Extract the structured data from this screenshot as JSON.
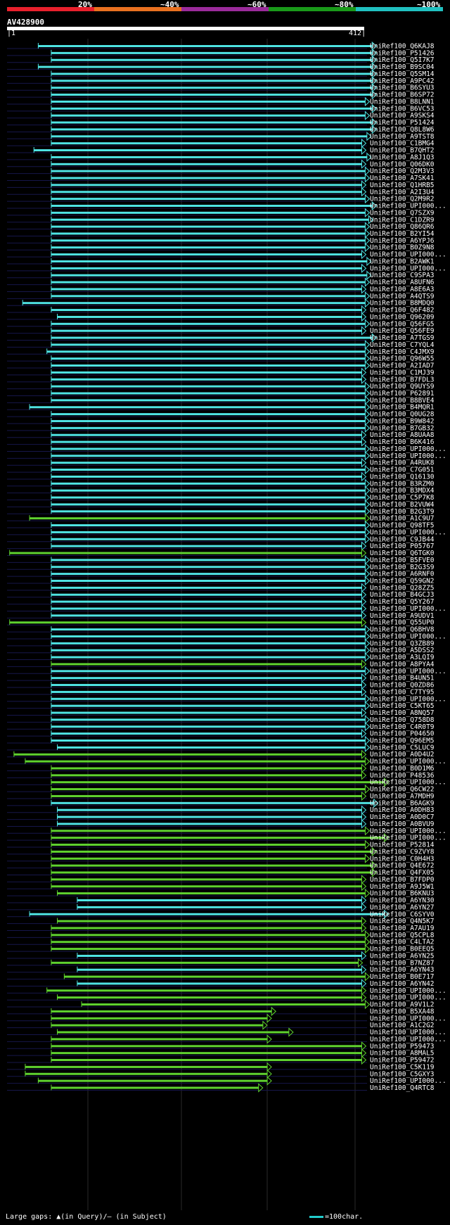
{
  "chart_data": {
    "type": "bar",
    "query": {
      "name": "AV428900",
      "start": 1,
      "end": 412
    },
    "identity_legend": [
      {
        "label": "20%",
        "color": "#e8202c"
      },
      {
        "label": "~40%",
        "color": "#e87020"
      },
      {
        "label": "~60%",
        "color": "#9b2b9b"
      },
      {
        "label": "~80%",
        "color": "#1a9a1a"
      },
      {
        "label": "~100%",
        "color": "#20c0c0"
      }
    ],
    "grid": true,
    "hits": [
      {
        "label": "UniRef100_Q6KAJ8",
        "start": 36,
        "end": 426,
        "color": "#4fe3e3"
      },
      {
        "label": "UniRef100_P51426",
        "start": 51,
        "end": 426,
        "color": "#4fe3e3"
      },
      {
        "label": "UniRef100_Q5I7K7",
        "start": 51,
        "end": 426,
        "color": "#4fe3e3"
      },
      {
        "label": "UniRef100_B9SC04",
        "start": 36,
        "end": 426,
        "color": "#4fe3e3"
      },
      {
        "label": "UniRef100_Q5SM14",
        "start": 51,
        "end": 426,
        "color": "#4fe3e3"
      },
      {
        "label": "UniRef100_A9PC42",
        "start": 51,
        "end": 426,
        "color": "#4fe3e3"
      },
      {
        "label": "UniRef100_B6SYU3",
        "start": 51,
        "end": 426,
        "color": "#4fe3e3"
      },
      {
        "label": "UniRef100_B6SP72",
        "start": 51,
        "end": 426,
        "color": "#4fe3e3"
      },
      {
        "label": "UniRef100_B8LNN1",
        "start": 51,
        "end": 418,
        "color": "#4fe3e3"
      },
      {
        "label": "UniRef100_B6VC53",
        "start": 51,
        "end": 426,
        "color": "#4fe3e3"
      },
      {
        "label": "UniRef100_A9SKS4",
        "start": 51,
        "end": 418,
        "color": "#4fe3e3"
      },
      {
        "label": "UniRef100_P51424",
        "start": 51,
        "end": 426,
        "color": "#4fe3e3"
      },
      {
        "label": "UniRef100_Q8L8W6",
        "start": 51,
        "end": 426,
        "color": "#4fe3e3"
      },
      {
        "label": "UniRef100_A9TST8",
        "start": 51,
        "end": 420,
        "color": "#4fe3e3"
      },
      {
        "label": "UniRef100_C1BMG4",
        "start": 51,
        "end": 414,
        "color": "#4fe3e3"
      },
      {
        "label": "UniRef100_B7QHT2",
        "start": 31,
        "end": 414,
        "color": "#4fe3e3"
      },
      {
        "label": "UniRef100_A8J1Q3",
        "start": 51,
        "end": 420,
        "color": "#4fe3e3"
      },
      {
        "label": "UniRef100_Q06DK0",
        "start": 51,
        "end": 414,
        "color": "#4fe3e3"
      },
      {
        "label": "UniRef100_Q2M3V3",
        "start": 51,
        "end": 418,
        "color": "#4fe3e3"
      },
      {
        "label": "UniRef100_A7SK41",
        "start": 51,
        "end": 418,
        "color": "#4fe3e3"
      },
      {
        "label": "UniRef100_Q1HRB5",
        "start": 51,
        "end": 414,
        "color": "#4fe3e3"
      },
      {
        "label": "UniRef100_A2I3U4",
        "start": 51,
        "end": 414,
        "color": "#4fe3e3"
      },
      {
        "label": "UniRef100_Q2M9R2",
        "start": 51,
        "end": 418,
        "color": "#4fe3e3"
      },
      {
        "label": "UniRef100_UPI000...",
        "start": 51,
        "end": 426,
        "color": "#4fe3e3"
      },
      {
        "label": "UniRef100_Q7SZX9",
        "start": 51,
        "end": 418,
        "color": "#4fe3e3"
      },
      {
        "label": "UniRef100_C1DZR9",
        "start": 51,
        "end": 422,
        "color": "#4fe3e3"
      },
      {
        "label": "UniRef100_Q86QR6",
        "start": 51,
        "end": 418,
        "color": "#4fe3e3"
      },
      {
        "label": "UniRef100_B2YI54",
        "start": 51,
        "end": 418,
        "color": "#4fe3e3"
      },
      {
        "label": "UniRef100_A6YPJ6",
        "start": 51,
        "end": 418,
        "color": "#4fe3e3"
      },
      {
        "label": "UniRef100_B0Z9N8",
        "start": 51,
        "end": 418,
        "color": "#4fe3e3"
      },
      {
        "label": "UniRef100_UPI000...",
        "start": 51,
        "end": 414,
        "color": "#4fe3e3"
      },
      {
        "label": "UniRef100_B2AWK1",
        "start": 51,
        "end": 420,
        "color": "#4fe3e3"
      },
      {
        "label": "UniRef100_UPI000...",
        "start": 51,
        "end": 414,
        "color": "#4fe3e3"
      },
      {
        "label": "UniRef100_C9SPA3",
        "start": 51,
        "end": 420,
        "color": "#4fe3e3"
      },
      {
        "label": "UniRef100_A8UFN6",
        "start": 51,
        "end": 418,
        "color": "#4fe3e3"
      },
      {
        "label": "UniRef100_A8E6A3",
        "start": 51,
        "end": 414,
        "color": "#4fe3e3"
      },
      {
        "label": "UniRef100_A4QTS9",
        "start": 51,
        "end": 418,
        "color": "#4fe3e3"
      },
      {
        "label": "UniRef100_B8MDQ0",
        "start": 18,
        "end": 418,
        "color": "#4fe3e3"
      },
      {
        "label": "UniRef100_Q6F482",
        "start": 51,
        "end": 414,
        "color": "#4fe3e3"
      },
      {
        "label": "UniRef100_Q96209",
        "start": 58,
        "end": 414,
        "color": "#4fe3e3"
      },
      {
        "label": "UniRef100_Q56FG5",
        "start": 51,
        "end": 418,
        "color": "#4fe3e3"
      },
      {
        "label": "UniRef100_Q56FE9",
        "start": 51,
        "end": 414,
        "color": "#4fe3e3"
      },
      {
        "label": "UniRef100_A7TGS9",
        "start": 51,
        "end": 426,
        "color": "#4fe3e3"
      },
      {
        "label": "UniRef100_C7YQL4",
        "start": 51,
        "end": 418,
        "color": "#4fe3e3"
      },
      {
        "label": "UniRef100_C4JMX9",
        "start": 46,
        "end": 418,
        "color": "#4fe3e3"
      },
      {
        "label": "UniRef100_Q96W55",
        "start": 51,
        "end": 418,
        "color": "#4fe3e3"
      },
      {
        "label": "UniRef100_A2IAD7",
        "start": 51,
        "end": 418,
        "color": "#4fe3e3"
      },
      {
        "label": "UniRef100_C1MJ39",
        "start": 51,
        "end": 414,
        "color": "#4fe3e3"
      },
      {
        "label": "UniRef100_B7FDL3",
        "start": 51,
        "end": 414,
        "color": "#4fe3e3"
      },
      {
        "label": "UniRef100_Q9UYS9",
        "start": 51,
        "end": 418,
        "color": "#4fe3e3"
      },
      {
        "label": "UniRef100_P62891",
        "start": 51,
        "end": 418,
        "color": "#4fe3e3"
      },
      {
        "label": "UniRef100_B8BVE4",
        "start": 51,
        "end": 418,
        "color": "#4fe3e3"
      },
      {
        "label": "UniRef100_B4MQR1",
        "start": 26,
        "end": 418,
        "color": "#4fe3e3"
      },
      {
        "label": "UniRef100_Q0UG28",
        "start": 51,
        "end": 418,
        "color": "#4fe3e3"
      },
      {
        "label": "UniRef100_B9W842",
        "start": 51,
        "end": 418,
        "color": "#4fe3e3"
      },
      {
        "label": "UniRef100_B7GB32",
        "start": 51,
        "end": 418,
        "color": "#4fe3e3"
      },
      {
        "label": "UniRef100_A8UAA8",
        "start": 51,
        "end": 414,
        "color": "#4fe3e3"
      },
      {
        "label": "UniRef100_B6K416",
        "start": 51,
        "end": 414,
        "color": "#4fe3e3"
      },
      {
        "label": "UniRef100_UPI000...",
        "start": 51,
        "end": 418,
        "color": "#4fe3e3"
      },
      {
        "label": "UniRef100_UPI000...",
        "start": 51,
        "end": 418,
        "color": "#4fe3e3"
      },
      {
        "label": "UniRef100_A4RUK8",
        "start": 51,
        "end": 414,
        "color": "#4fe3e3"
      },
      {
        "label": "UniRef100_C7G051",
        "start": 51,
        "end": 418,
        "color": "#4fe3e3"
      },
      {
        "label": "UniRef100_Q16130",
        "start": 51,
        "end": 414,
        "color": "#4fe3e3"
      },
      {
        "label": "UniRef100_B3RZM0",
        "start": 51,
        "end": 418,
        "color": "#4fe3e3"
      },
      {
        "label": "UniRef100_B3MDX4",
        "start": 51,
        "end": 418,
        "color": "#4fe3e3"
      },
      {
        "label": "UniRef100_C5P7K8",
        "start": 51,
        "end": 418,
        "color": "#4fe3e3"
      },
      {
        "label": "UniRef100_B2VUW4",
        "start": 51,
        "end": 418,
        "color": "#4fe3e3"
      },
      {
        "label": "UniRef100_B2G3T9",
        "start": 51,
        "end": 418,
        "color": "#4fe3e3"
      },
      {
        "label": "UniRef100_A1C9U7",
        "start": 26,
        "end": 418,
        "color": "#5fd22f"
      },
      {
        "label": "UniRef100_Q98TF5",
        "start": 51,
        "end": 418,
        "color": "#4fe3e3"
      },
      {
        "label": "UniRef100_UPI000...",
        "start": 51,
        "end": 418,
        "color": "#4fe3e3"
      },
      {
        "label": "UniRef100_C9JB44",
        "start": 51,
        "end": 418,
        "color": "#4fe3e3"
      },
      {
        "label": "UniRef100_P05767",
        "start": 51,
        "end": 414,
        "color": "#4fe3e3"
      },
      {
        "label": "UniRef100_Q6TGK0",
        "start": 3,
        "end": 414,
        "color": "#5fd22f"
      },
      {
        "label": "UniRef100_B5FVE0",
        "start": 51,
        "end": 418,
        "color": "#4fe3e3"
      },
      {
        "label": "UniRef100_B2G3S9",
        "start": 51,
        "end": 418,
        "color": "#4fe3e3"
      },
      {
        "label": "UniRef100_A6RNF0",
        "start": 51,
        "end": 418,
        "color": "#4fe3e3"
      },
      {
        "label": "UniRef100_Q59GN2",
        "start": 51,
        "end": 418,
        "color": "#4fe3e3"
      },
      {
        "label": "UniRef100_Q28ZZ5",
        "start": 51,
        "end": 414,
        "color": "#4fe3e3"
      },
      {
        "label": "UniRef100_B4GCJ3",
        "start": 51,
        "end": 414,
        "color": "#4fe3e3"
      },
      {
        "label": "UniRef100_Q5Y267",
        "start": 51,
        "end": 414,
        "color": "#4fe3e3"
      },
      {
        "label": "UniRef100_UPI000...",
        "start": 51,
        "end": 414,
        "color": "#4fe3e3"
      },
      {
        "label": "UniRef100_A9UDV1",
        "start": 51,
        "end": 414,
        "color": "#4fe3e3"
      },
      {
        "label": "UniRef100_Q55UP0",
        "start": 3,
        "end": 414,
        "color": "#5fd22f"
      },
      {
        "label": "UniRef100_Q6BHV8",
        "start": 51,
        "end": 418,
        "color": "#4fe3e3"
      },
      {
        "label": "UniRef100_UPI000...",
        "start": 51,
        "end": 418,
        "color": "#4fe3e3"
      },
      {
        "label": "UniRef100_Q3ZB89",
        "start": 51,
        "end": 418,
        "color": "#4fe3e3"
      },
      {
        "label": "UniRef100_A5DSS2",
        "start": 51,
        "end": 418,
        "color": "#4fe3e3"
      },
      {
        "label": "UniRef100_A3LQI9",
        "start": 51,
        "end": 418,
        "color": "#4fe3e3"
      },
      {
        "label": "UniRef100_A8PYA4",
        "start": 51,
        "end": 414,
        "color": "#5fd22f"
      },
      {
        "label": "UniRef100_UPI000...",
        "start": 51,
        "end": 418,
        "color": "#4fe3e3"
      },
      {
        "label": "UniRef100_B4UN51",
        "start": 51,
        "end": 414,
        "color": "#4fe3e3"
      },
      {
        "label": "UniRef100_Q0ZD86",
        "start": 51,
        "end": 414,
        "color": "#4fe3e3"
      },
      {
        "label": "UniRef100_C7TY95",
        "start": 51,
        "end": 414,
        "color": "#4fe3e3"
      },
      {
        "label": "UniRef100_UPI000...",
        "start": 51,
        "end": 418,
        "color": "#4fe3e3"
      },
      {
        "label": "UniRef100_C5KT65",
        "start": 51,
        "end": 418,
        "color": "#4fe3e3"
      },
      {
        "label": "UniRef100_A8NQ57",
        "start": 51,
        "end": 414,
        "color": "#4fe3e3"
      },
      {
        "label": "UniRef100_Q758D8",
        "start": 51,
        "end": 418,
        "color": "#4fe3e3"
      },
      {
        "label": "UniRef100_C4R0T9",
        "start": 51,
        "end": 418,
        "color": "#4fe3e3"
      },
      {
        "label": "UniRef100_P04650",
        "start": 51,
        "end": 414,
        "color": "#4fe3e3"
      },
      {
        "label": "UniRef100_Q96EM5",
        "start": 51,
        "end": 418,
        "color": "#4fe3e3"
      },
      {
        "label": "UniRef100_C5LUC9",
        "start": 58,
        "end": 418,
        "color": "#4fe3e3"
      },
      {
        "label": "UniRef100_A0D4U2",
        "start": 8,
        "end": 414,
        "color": "#5fd22f"
      },
      {
        "label": "UniRef100_UPI000...",
        "start": 21,
        "end": 418,
        "color": "#5fd22f"
      },
      {
        "label": "UniRef100_B0D1M6",
        "start": 51,
        "end": 414,
        "color": "#5fd22f"
      },
      {
        "label": "UniRef100_P48536",
        "start": 51,
        "end": 414,
        "color": "#5fd22f"
      },
      {
        "label": "UniRef100_UPI000...",
        "start": 51,
        "end": 440,
        "color": "#5fd22f"
      },
      {
        "label": "UniRef100_Q6CW22",
        "start": 51,
        "end": 418,
        "color": "#5fd22f"
      },
      {
        "label": "UniRef100_A7MDH9",
        "start": 51,
        "end": 414,
        "color": "#5fd22f"
      },
      {
        "label": "UniRef100_B6AGK9",
        "start": 51,
        "end": 428,
        "color": "#4fe3e3"
      },
      {
        "label": "UniRef100_A0DH83",
        "start": 58,
        "end": 414,
        "color": "#4fe3e3"
      },
      {
        "label": "UniRef100_A0D0C7",
        "start": 58,
        "end": 414,
        "color": "#4fe3e3"
      },
      {
        "label": "UniRef100_A0BVU9",
        "start": 58,
        "end": 414,
        "color": "#4fe3e3"
      },
      {
        "label": "UniRef100_UPI000...",
        "start": 51,
        "end": 418,
        "color": "#5fd22f"
      },
      {
        "label": "UniRef100_UPI000...",
        "start": 51,
        "end": 440,
        "color": "#5fd22f"
      },
      {
        "label": "UniRef100_P52814",
        "start": 51,
        "end": 418,
        "color": "#5fd22f"
      },
      {
        "label": "UniRef100_C9ZVY8",
        "start": 51,
        "end": 426,
        "color": "#5fd22f"
      },
      {
        "label": "UniRef100_C0H4H3",
        "start": 51,
        "end": 418,
        "color": "#5fd22f"
      },
      {
        "label": "UniRef100_Q4E672",
        "start": 51,
        "end": 426,
        "color": "#5fd22f"
      },
      {
        "label": "UniRef100_Q4FX05",
        "start": 51,
        "end": 426,
        "color": "#5fd22f"
      },
      {
        "label": "UniRef100_B7FDP0",
        "start": 51,
        "end": 414,
        "color": "#5fd22f"
      },
      {
        "label": "UniRef100_A9J5W1",
        "start": 51,
        "end": 414,
        "color": "#5fd22f"
      },
      {
        "label": "UniRef100_B6KNU3",
        "start": 58,
        "end": 418,
        "color": "#5fd22f"
      },
      {
        "label": "UniRef100_A6YN30",
        "start": 81,
        "end": 414,
        "color": "#4fe3e3"
      },
      {
        "label": "UniRef100_A6YN27",
        "start": 81,
        "end": 414,
        "color": "#4fe3e3"
      },
      {
        "label": "UniRef100_C6SYV0",
        "start": 26,
        "end": 440,
        "color": "#4fe3e3"
      },
      {
        "label": "UniRef100_Q4N5K7",
        "start": 58,
        "end": 414,
        "color": "#5fd22f"
      },
      {
        "label": "UniRef100_A7AU19",
        "start": 51,
        "end": 414,
        "color": "#5fd22f"
      },
      {
        "label": "UniRef100_Q5CPL8",
        "start": 51,
        "end": 418,
        "color": "#5fd22f"
      },
      {
        "label": "UniRef100_C4LTA2",
        "start": 51,
        "end": 418,
        "color": "#5fd22f"
      },
      {
        "label": "UniRef100_B0EEQ5",
        "start": 51,
        "end": 418,
        "color": "#5fd22f"
      },
      {
        "label": "UniRef100_A6YN25",
        "start": 81,
        "end": 414,
        "color": "#4fe3e3"
      },
      {
        "label": "UniRef100_B7NZ87",
        "start": 51,
        "end": 410,
        "color": "#5fd22f"
      },
      {
        "label": "UniRef100_A6YN43",
        "start": 81,
        "end": 414,
        "color": "#4fe3e3"
      },
      {
        "label": "UniRef100_B0E717",
        "start": 66,
        "end": 418,
        "color": "#5fd22f"
      },
      {
        "label": "UniRef100_A6YN42",
        "start": 81,
        "end": 414,
        "color": "#4fe3e3"
      },
      {
        "label": "UniRef100_UPI000...",
        "start": 46,
        "end": 414,
        "color": "#5fd22f"
      },
      {
        "label": "UniRef100_UPI000...",
        "start": 58,
        "end": 414,
        "color": "#5fd22f"
      },
      {
        "label": "UniRef100_A9V1L2",
        "start": 86,
        "end": 418,
        "color": "#5fd22f"
      },
      {
        "label": "UniRef100_B5XA48",
        "start": 51,
        "end": 310,
        "color": "#5fd22f"
      },
      {
        "label": "UniRef100_UPI000...",
        "start": 51,
        "end": 305,
        "color": "#5fd22f"
      },
      {
        "label": "UniRef100_A1C2G2",
        "start": 51,
        "end": 300,
        "color": "#5fd22f"
      },
      {
        "label": "UniRef100_UPI000...",
        "start": 58,
        "end": 330,
        "color": "#5fd22f"
      },
      {
        "label": "UniRef100_UPI000...",
        "start": 51,
        "end": 305,
        "color": "#5fd22f"
      },
      {
        "label": "UniRef100_P59473",
        "start": 51,
        "end": 414,
        "color": "#5fd22f"
      },
      {
        "label": "UniRef100_A8MAL5",
        "start": 51,
        "end": 414,
        "color": "#5fd22f"
      },
      {
        "label": "UniRef100_P59472",
        "start": 51,
        "end": 414,
        "color": "#5fd22f"
      },
      {
        "label": "UniRef100_C5K119",
        "start": 21,
        "end": 305,
        "color": "#5fd22f"
      },
      {
        "label": "UniRef100_C5GXY3",
        "start": 21,
        "end": 305,
        "color": "#5fd22f"
      },
      {
        "label": "UniRef100_UPI000...",
        "start": 36,
        "end": 305,
        "color": "#5fd22f"
      },
      {
        "label": "UniRef100_Q4RTC8",
        "start": 51,
        "end": 295,
        "color": "#5fd22f"
      }
    ]
  },
  "footer": {
    "gaps_text": "Large gaps: ▲(in Query)/— (in Subject)",
    "scale_text": "=100char."
  }
}
